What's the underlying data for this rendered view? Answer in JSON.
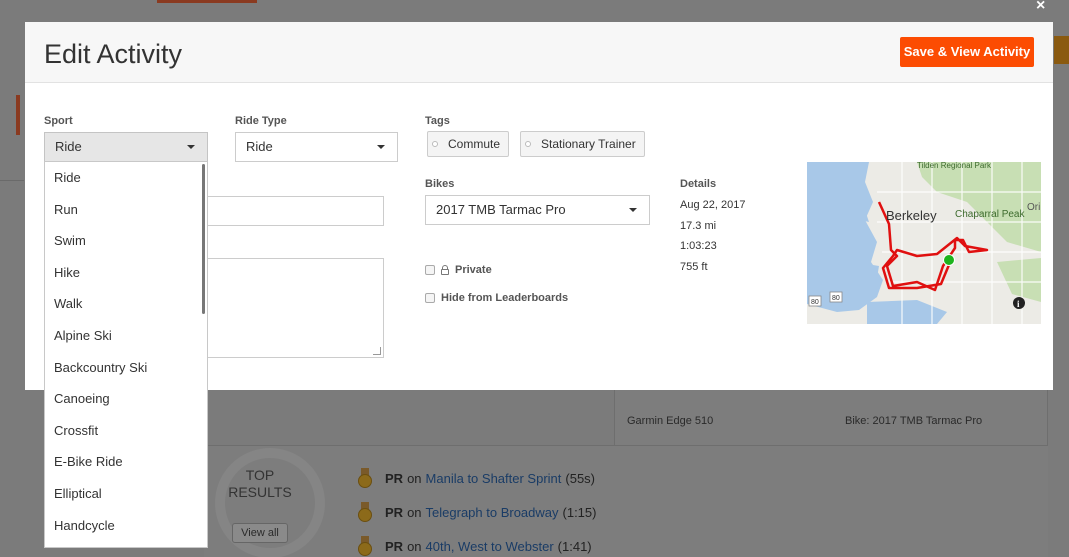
{
  "modal": {
    "title": "Edit Activity",
    "save_label": "Save & View Activity"
  },
  "sport": {
    "label": "Sport",
    "value": "Ride",
    "options": [
      "Ride",
      "Run",
      "Swim",
      "Hike",
      "Walk",
      "Alpine Ski",
      "Backcountry Ski",
      "Canoeing",
      "Crossfit",
      "E-Bike Ride",
      "Elliptical",
      "Handcycle"
    ]
  },
  "ride_type": {
    "label": "Ride Type",
    "value": "Ride"
  },
  "tags": {
    "label": "Tags",
    "items": [
      "Commute",
      "Stationary Trainer"
    ]
  },
  "bikes": {
    "label": "Bikes",
    "value": "2017 TMB Tarmac Pro"
  },
  "privacy": {
    "private_label": "Private",
    "hide_leaderboards_label": "Hide from Leaderboards"
  },
  "details": {
    "label": "Details",
    "date": "Aug 22, 2017",
    "distance": "17.3 mi",
    "duration": "1:03:23",
    "elevation": "755 ft"
  },
  "map": {
    "labels": {
      "city": "Berkeley",
      "park": "Tilden Regional Park",
      "peak": "Chaparral Peak",
      "edge_text": "Orin",
      "road_80a": "80",
      "road_80b": "80"
    },
    "colors": {
      "water": "#a8c8e8",
      "land": "#ecebe6",
      "green": "#c8dfb4",
      "route": "#e01010",
      "start": "#1db31d"
    }
  },
  "background": {
    "device": "Garmin Edge 510",
    "bike": "Bike: 2017 TMB Tarmac Pro",
    "top_results_title": "TOP RESULTS",
    "view_all": "View all",
    "results": [
      {
        "label": "PR",
        "on": "on",
        "segment": "Manila to Shafter Sprint",
        "time": "(55s)"
      },
      {
        "label": "PR",
        "on": "on",
        "segment": "Telegraph to Broadway",
        "time": "(1:15)"
      },
      {
        "label": "PR",
        "on": "on",
        "segment": "40th, West to Webster",
        "time": "(1:41)"
      }
    ]
  },
  "colors": {
    "accent": "#fc4c02"
  }
}
